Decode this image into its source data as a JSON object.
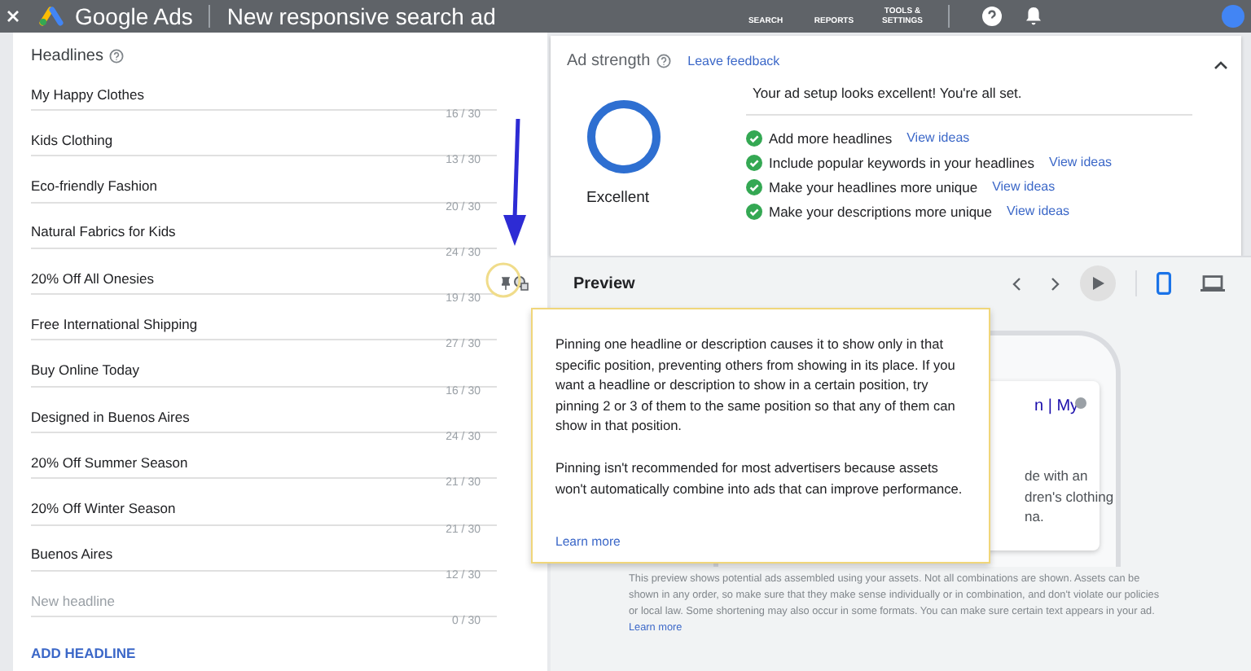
{
  "top_bar": {
    "title": "Google Ads",
    "page_title": "New responsive search ad",
    "nav": [
      {
        "label": "SEARCH"
      },
      {
        "label": "REPORTS"
      },
      {
        "label": "TOOLS & SETTINGS"
      }
    ]
  },
  "headlines": {
    "title": "Headlines",
    "fields": [
      {
        "value": "My Happy Clothes",
        "counter": "16 / 30",
        "pin_controls": false
      },
      {
        "value": "Kids Clothing",
        "counter": "13 / 30",
        "pin_controls": false
      },
      {
        "value": "Eco-friendly Fashion",
        "counter": "20 / 30",
        "pin_controls": false
      },
      {
        "value": "Natural Fabrics for Kids",
        "counter": "24 / 30",
        "pin_controls": false
      },
      {
        "value": "20% Off All Onesies",
        "counter": "19 / 30",
        "pin_controls": true
      },
      {
        "value": "Free International Shipping",
        "counter": "27 / 30",
        "pin_controls": false
      },
      {
        "value": "Buy Online Today",
        "counter": "16 / 30",
        "pin_controls": false
      },
      {
        "value": "Designed in Buenos Aires",
        "counter": "24 / 30",
        "pin_controls": false
      },
      {
        "value": "20% Off Summer Season",
        "counter": "21 / 30",
        "pin_controls": false
      },
      {
        "value": "20% Off Winter Season",
        "counter": "21 / 30",
        "pin_controls": false
      },
      {
        "value": "Buenos Aires",
        "counter": "12 / 30",
        "pin_controls": false
      },
      {
        "placeholder": "New headline",
        "counter": "0 / 30",
        "pin_controls": false
      }
    ],
    "add_button": "ADD HEADLINE"
  },
  "ad_strength": {
    "title": "Ad strength",
    "feedback_link": "Leave feedback",
    "rating": "Excellent",
    "summary": "Your ad setup looks excellent! You're all set.",
    "items": [
      {
        "text": "Add more headlines",
        "link": "View ideas",
        "done": true
      },
      {
        "text": "Include popular keywords in your headlines",
        "link": "View ideas",
        "done": true
      },
      {
        "text": "Make your headlines more unique",
        "link": "View ideas",
        "done": true
      },
      {
        "text": "Make your descriptions more unique",
        "link": "View ideas",
        "done": true
      }
    ]
  },
  "preview": {
    "title": "Preview",
    "devices": [
      {
        "kind": "mobile",
        "selected": true
      },
      {
        "kind": "desktop",
        "selected": false
      }
    ],
    "ad_headline": "n | My",
    "ad_lines": [
      "de with an",
      "dren's clothing",
      "na."
    ],
    "disclaimer": "This preview shows potential ads assembled using your assets. Not all combinations are shown. Assets can be shown in any order, so make sure that they make sense individually or in combination, and don't violate our policies or local law. Some shortening may also occur in some formats. You can make sure certain text appears in your ad.",
    "disclaimer_link": "Learn more"
  },
  "tooltip": {
    "paragraphs": [
      "Pinning one headline or description causes it to show only in that specific position, preventing others from showing in its place. If you want a headline or description to show in a certain position, try pinning 2 or 3 of them to the same position so that any of them can show in that position.",
      "Pinning isn't recommended for most advertisers because assets won't automatically combine into ads that can improve performance."
    ],
    "link": "Learn more"
  }
}
